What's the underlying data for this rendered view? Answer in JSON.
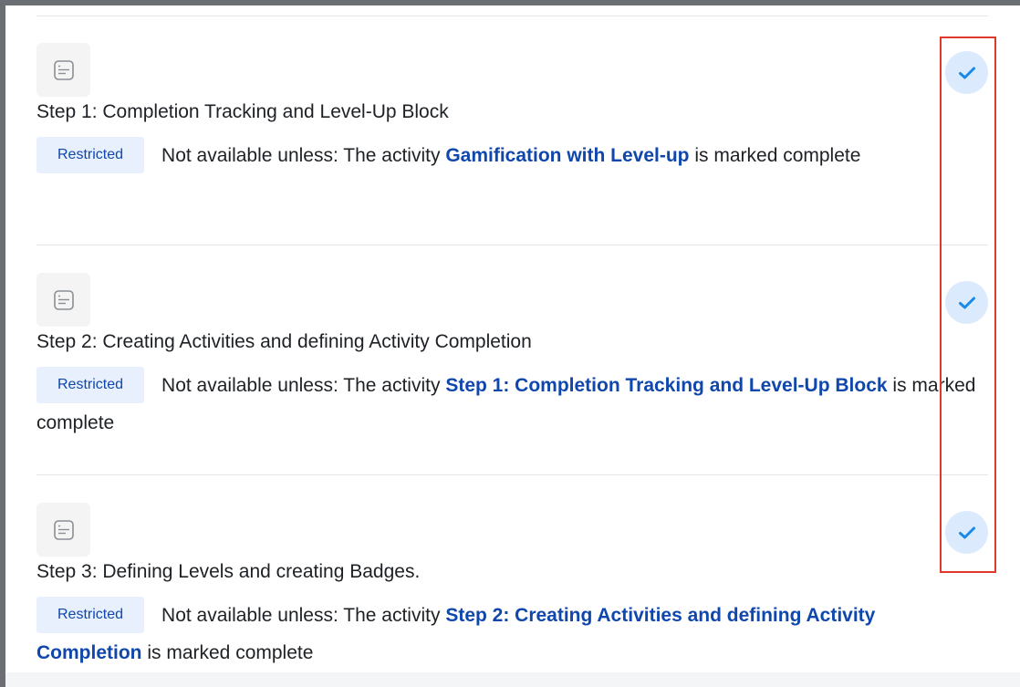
{
  "activities": [
    {
      "title": "Step 1: Completion Tracking and Level-Up Block",
      "badge": "Restricted",
      "prefix": "Not available unless: The activity ",
      "link": "Gamification with Level-up",
      "suffix": " is marked complete",
      "completed": true
    },
    {
      "title": "Step 2: Creating Activities and defining Activity Completion",
      "badge": "Restricted",
      "prefix": "Not available unless: The activity ",
      "link": "Step 1: Completion Tracking and Level-Up Block",
      "suffix": " is marked complete",
      "completed": true
    },
    {
      "title": "Step 3: Defining Levels and creating Badges.",
      "badge": "Restricted",
      "prefix": "Not available unless: The activity ",
      "link": "Step 2: Creating Activities and defining Activity Completion",
      "suffix": " is marked complete",
      "completed": true
    }
  ],
  "icons": {
    "activity": "page-icon",
    "completion": "checkmark-icon"
  },
  "colors": {
    "link": "#0f47ad",
    "badge_bg": "#e8f0fd",
    "check_bg": "#dbeafd",
    "check": "#1a8ae8",
    "highlight": "#e0382a"
  }
}
